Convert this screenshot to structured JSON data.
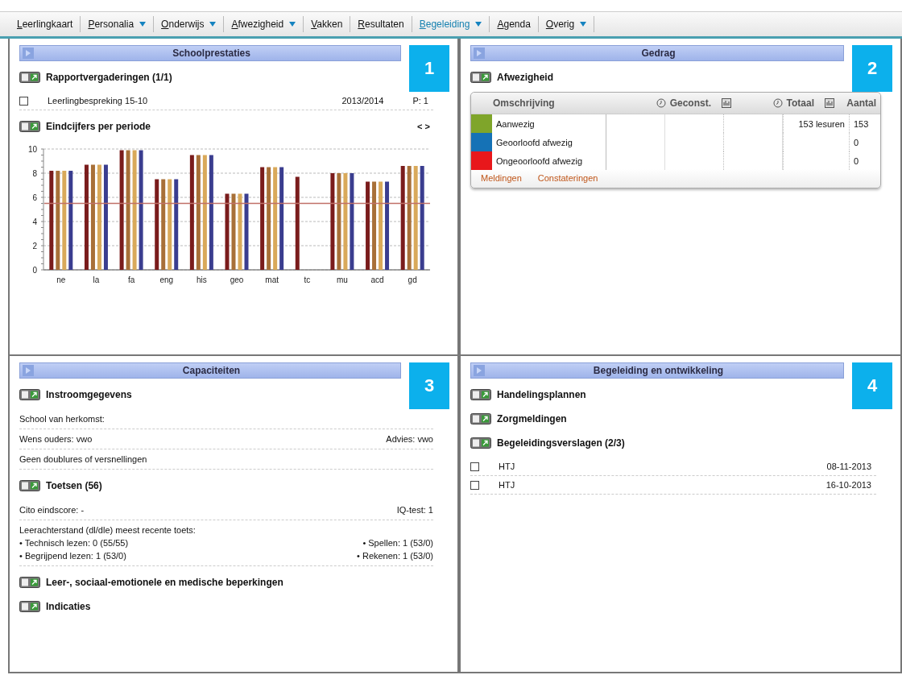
{
  "menu": [
    {
      "label": "Leerlingkaart",
      "dropdown": false,
      "selected": false
    },
    {
      "label": "Personalia",
      "dropdown": true,
      "selected": false
    },
    {
      "label": "Onderwijs",
      "dropdown": true,
      "selected": false
    },
    {
      "label": "Afwezigheid",
      "dropdown": true,
      "selected": false
    },
    {
      "label": "Vakken",
      "dropdown": false,
      "selected": false
    },
    {
      "label": "Resultaten",
      "dropdown": false,
      "selected": false
    },
    {
      "label": "Begeleiding",
      "dropdown": true,
      "selected": true
    },
    {
      "label": "Agenda",
      "dropdown": false,
      "selected": false
    },
    {
      "label": "Overig",
      "dropdown": true,
      "selected": false
    }
  ],
  "panels": [
    {
      "title": "Schoolprestaties",
      "badge": "1",
      "sections": [
        {
          "kind": "checklist",
          "title": "Rapportvergaderingen (1/1)",
          "items": [
            {
              "checked": false,
              "label": "Leerlingbespreking 15-10",
              "cells": [
                "2013/2014",
                "P: 1"
              ]
            }
          ]
        },
        {
          "kind": "chart",
          "title": "Eindcijfers per periode",
          "nav": "< >",
          "chart_data": {
            "type": "bar",
            "categories": [
              "ne",
              "la",
              "fa",
              "eng",
              "his",
              "geo",
              "mat",
              "tc",
              "mu",
              "acd",
              "gd"
            ],
            "ylim": [
              0,
              10
            ],
            "yticks": [
              0,
              2,
              4,
              6,
              8,
              10
            ],
            "series": [
              {
                "color": "#7a1c1c",
                "values": [
                  8.2,
                  8.7,
                  9.9,
                  7.5,
                  9.5,
                  6.3,
                  8.5,
                  7.7,
                  8.0,
                  7.3,
                  8.6
                ]
              },
              {
                "color": "#a87038",
                "values": [
                  8.2,
                  8.7,
                  9.9,
                  7.5,
                  9.5,
                  6.3,
                  8.5,
                  null,
                  8.0,
                  7.3,
                  8.6
                ]
              },
              {
                "color": "#d9a95a",
                "values": [
                  8.2,
                  8.7,
                  9.9,
                  7.5,
                  9.5,
                  6.3,
                  8.5,
                  null,
                  8.0,
                  7.3,
                  8.6
                ]
              },
              {
                "color": "#3a3d8f",
                "values": [
                  8.2,
                  8.7,
                  9.9,
                  7.5,
                  9.5,
                  6.3,
                  8.5,
                  null,
                  8.0,
                  7.3,
                  8.6
                ]
              }
            ],
            "grid": true,
            "ref_lines": [
              {
                "value": 5.5,
                "axis": "y"
              }
            ]
          }
        }
      ]
    },
    {
      "title": "Gedrag",
      "badge": "2",
      "sections": [
        {
          "kind": "table",
          "title": "Afwezigheid",
          "columns": [
            {
              "label": "Omschrijving"
            },
            {
              "label": "Geconst."
            },
            {
              "label": "Totaal"
            },
            {
              "label": "Aantal"
            }
          ],
          "rows": [
            {
              "color": "#7fa52a",
              "label": "Aanwezig",
              "total": "153 lesuren",
              "count": "153"
            },
            {
              "color": "#1572b6",
              "label": "Geoorloofd afwezig",
              "count": "0"
            },
            {
              "color": "#e8171b",
              "label": "Ongeoorloofd afwezig",
              "count": "0"
            }
          ],
          "links": [
            "Meldingen",
            "Constateringen"
          ]
        }
      ]
    },
    {
      "title": "Capaciteiten",
      "badge": "3",
      "sections": [
        {
          "kind": "info",
          "title": "Instroomgegevens",
          "groups": [
            [
              {
                "left": "School van herkomst:"
              }
            ],
            [
              {
                "left": "Wens ouders: vwo",
                "right": "Advies: vwo"
              }
            ],
            [
              {
                "left": "Geen doublures of versnellingen"
              }
            ]
          ]
        },
        {
          "kind": "info",
          "title": "Toetsen (56)",
          "groups": [
            [
              {
                "left": "Cito eindscore: -",
                "right": "IQ-test: 1"
              }
            ],
            [
              {
                "left": "Leerachterstand (dl/dle) meest recente toets:"
              },
              {
                "left": "• Technisch lezen: 0 (55/55)",
                "right": "• Spellen: 1 (53/0)"
              },
              {
                "left": "• Begrijpend lezen: 1 (53/0)",
                "right": "• Rekenen: 1 (53/0)"
              }
            ]
          ]
        },
        {
          "kind": "plain",
          "title": "Leer-, sociaal-emotionele en medische beperkingen"
        },
        {
          "kind": "plain",
          "title": "Indicaties"
        }
      ]
    },
    {
      "title": "Begeleiding en ontwikkeling",
      "badge": "4",
      "sections": [
        {
          "kind": "plain",
          "title": "Handelingsplannen"
        },
        {
          "kind": "plain",
          "title": "Zorgmeldingen"
        },
        {
          "kind": "checklist",
          "title": "Begeleidingsverslagen (2/3)",
          "items": [
            {
              "checked": false,
              "label": "HTJ",
              "cells": [
                "08-11-2013"
              ]
            },
            {
              "checked": false,
              "label": "HTJ",
              "cells": [
                "16-10-2013"
              ]
            }
          ]
        }
      ]
    }
  ]
}
